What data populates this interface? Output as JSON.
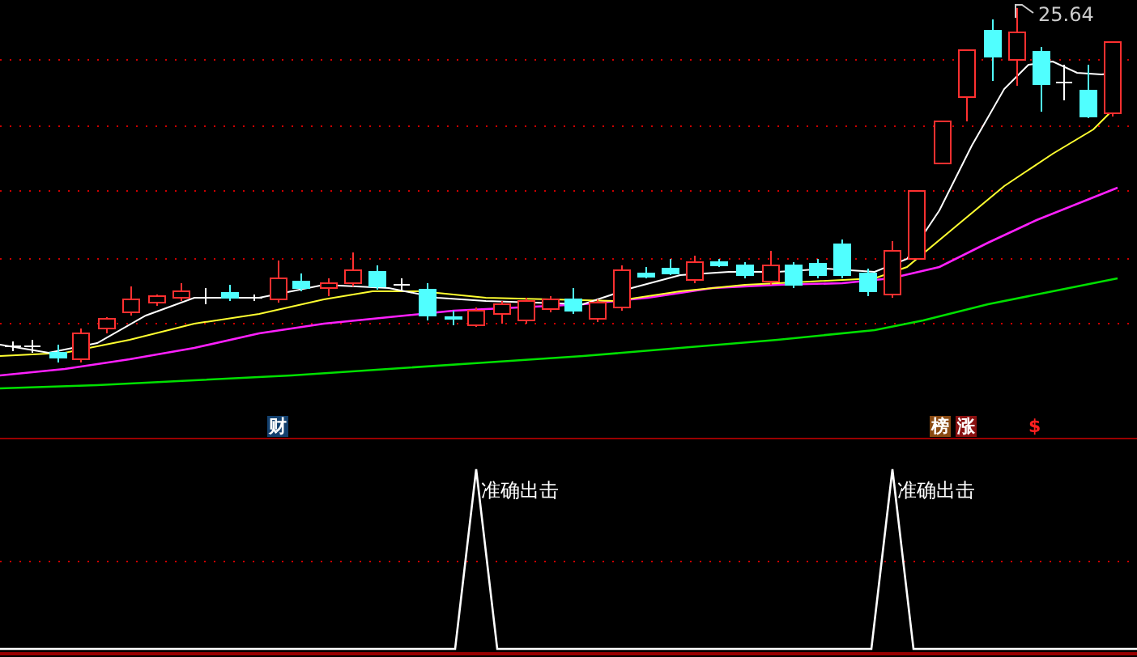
{
  "price_chart": {
    "high_label": "25.64"
  },
  "signal_markers": [
    {
      "text": "财",
      "kind": "badge",
      "color": "#13406e"
    },
    {
      "text": "榜",
      "kind": "badge",
      "color": "#8a4a12"
    },
    {
      "text": "涨",
      "kind": "badge",
      "color": "#8a1010"
    },
    {
      "text": "$",
      "kind": "plain",
      "color": "#ff2020"
    }
  ],
  "indicator": {
    "signals": [
      {
        "label": "准确出击"
      },
      {
        "label": "准确出击"
      }
    ]
  }
}
